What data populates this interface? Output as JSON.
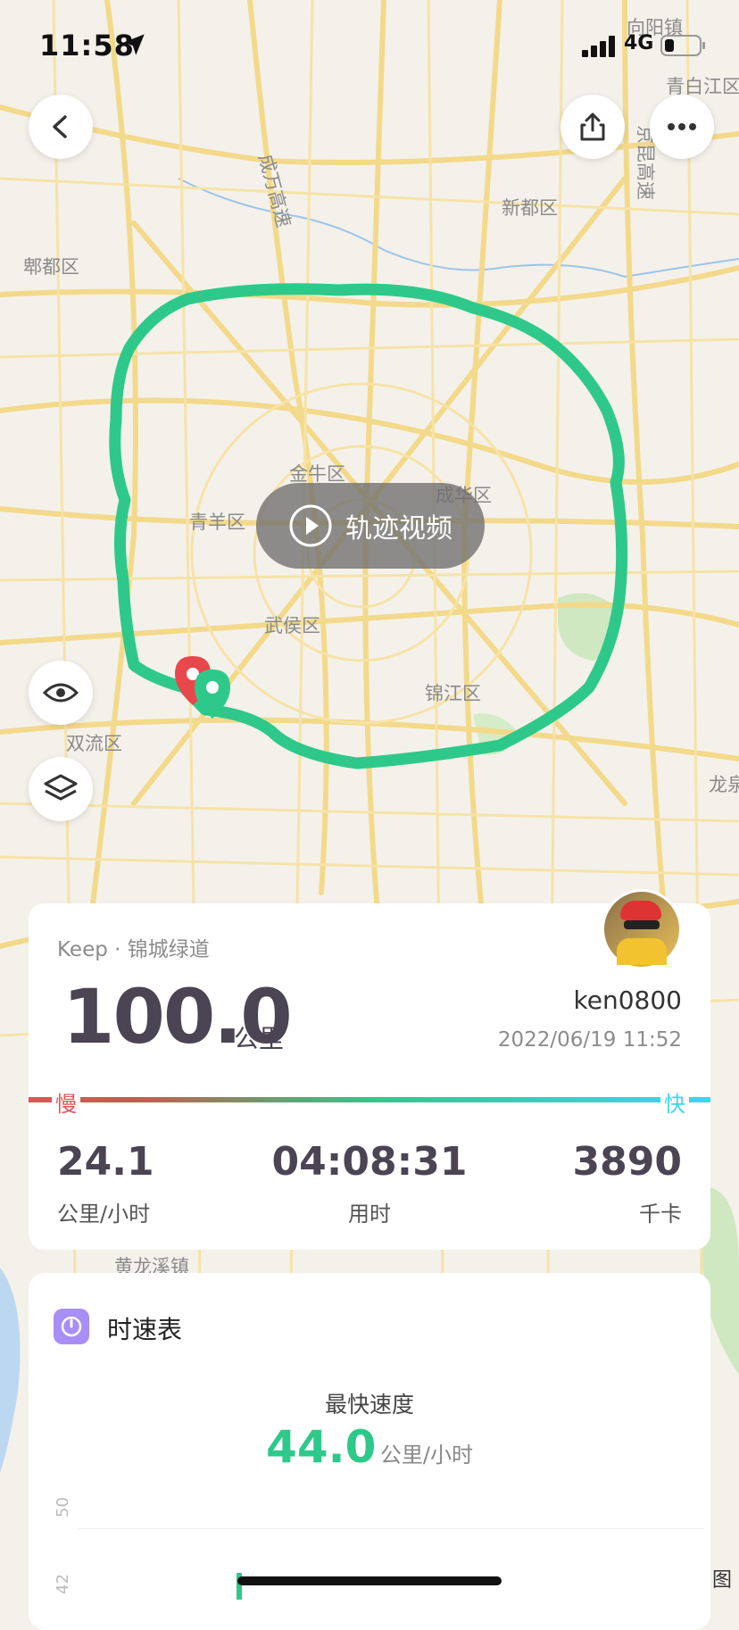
{
  "status_bar": {
    "time": "11:58",
    "network": "4G"
  },
  "map": {
    "districts": [
      {
        "label": "向阳镇"
      },
      {
        "label": "青白江区"
      },
      {
        "label": "新都区"
      },
      {
        "label": "郫都区"
      },
      {
        "label": "金牛区"
      },
      {
        "label": "成华区"
      },
      {
        "label": "青羊区"
      },
      {
        "label": "武侯区"
      },
      {
        "label": "锦江区"
      },
      {
        "label": "双流区"
      },
      {
        "label": "龙泉"
      },
      {
        "label": "黄龙溪镇"
      }
    ],
    "play_button_label": "轨迹视频",
    "road_labels": [
      "成万高速",
      "京昆高速"
    ]
  },
  "summary": {
    "source": "Keep · 锦城绿道",
    "distance": "100.0",
    "distance_unit": "公里",
    "username": "ken0800",
    "datetime": "2022/06/19 11:52",
    "pace_slow": "慢",
    "pace_fast": "快",
    "stats": [
      {
        "value": "24.1",
        "label": "公里/小时"
      },
      {
        "value": "04:08:31",
        "label": "用时"
      },
      {
        "value": "3890",
        "label": "千卡"
      }
    ]
  },
  "speed_card": {
    "title": "时速表",
    "max_label": "最快速度",
    "max_value": "44.0",
    "max_unit": "公里/小时",
    "axis_ticks": [
      "50",
      "42"
    ]
  },
  "corner_text": "图",
  "colors": {
    "route": "#2ec98a",
    "slow": "#e05555",
    "fast": "#3cd6f0",
    "accent": "#2ec98a",
    "card_icon": "#a98ef5"
  }
}
